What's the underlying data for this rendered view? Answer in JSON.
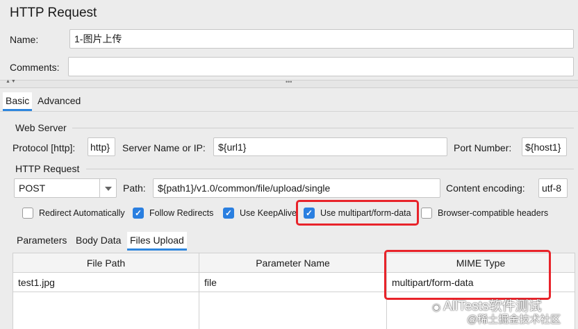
{
  "window": {
    "title": "HTTP Request"
  },
  "form": {
    "name_label": "Name:",
    "name_value": "1-图片上传",
    "comments_label": "Comments:",
    "comments_value": ""
  },
  "splitter": {
    "arrows": "▲▼",
    "grip": "•••"
  },
  "top_tabs": [
    {
      "label": "Basic",
      "active": true
    },
    {
      "label": "Advanced",
      "active": false
    }
  ],
  "web_server": {
    "section_title": "Web Server",
    "protocol_label": "Protocol [http]:",
    "protocol_value": "http}",
    "server_label": "Server Name or IP:",
    "server_value": "${url1}",
    "port_label": "Port Number:",
    "port_value": "${host1}"
  },
  "http_request": {
    "section_title": "HTTP Request",
    "method_value": "POST",
    "path_label": "Path:",
    "path_value": "${path1}/v1.0/common/file/upload/single",
    "encoding_label": "Content encoding:",
    "encoding_value": "utf-8"
  },
  "options": [
    {
      "label": "Redirect Automatically",
      "checked": false
    },
    {
      "label": "Follow Redirects",
      "checked": true
    },
    {
      "label": "Use KeepAlive",
      "checked": true
    },
    {
      "label": "Use multipart/form-data",
      "checked": true
    },
    {
      "label": "Browser-compatible headers",
      "checked": false
    }
  ],
  "sub_tabs": [
    {
      "label": "Parameters",
      "active": false
    },
    {
      "label": "Body Data",
      "active": false
    },
    {
      "label": "Files Upload",
      "active": true
    }
  ],
  "files_table": {
    "headers": [
      "File Path",
      "Parameter Name",
      "MIME Type"
    ],
    "rows": [
      [
        "test1.jpg",
        "file",
        "multipart/form-data"
      ]
    ]
  },
  "watermark": {
    "line1": "AllTests软件测试",
    "line2": "@稀土掘金技术社区"
  },
  "colors": {
    "accent": "#2a7fe0",
    "highlight": "#e8232a"
  }
}
